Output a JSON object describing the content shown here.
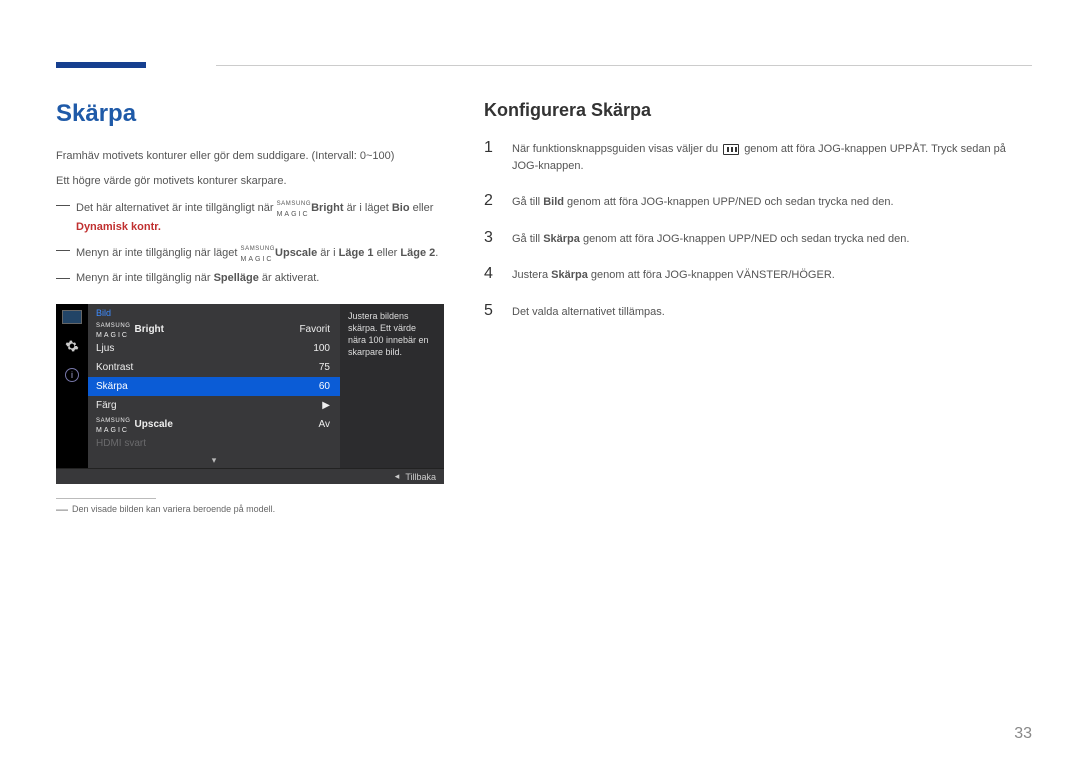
{
  "page_number": "33",
  "left": {
    "title": "Skärpa",
    "p1": "Framhäv motivets konturer eller gör dem suddigare. (Intervall: 0~100)",
    "p2": "Ett högre värde gör motivets konturer skarpare.",
    "note1_pre": "Det här alternativet är inte tillgängligt när ",
    "note1_brand_top": "SAMSUNG",
    "note1_brand_bot": "MAGIC",
    "note1_bright": "Bright",
    "note1_mid": " är i läget ",
    "note1_bio": "Bio",
    "note1_eller": " eller ",
    "note1_dyn": "Dynamisk kontr.",
    "note2_pre": "Menyn är inte tillgänglig när läget ",
    "note2_brand_top": "SAMSUNG",
    "note2_brand_bot": "MAGIC",
    "note2_upscale": "Upscale",
    "note2_mid": " är i ",
    "note2_l1": "Läge 1",
    "note2_eller": " eller ",
    "note2_l2": "Läge 2",
    "note2_end": ".",
    "note3_pre": "Menyn är inte tillgänglig när ",
    "note3_spel": "Spelläge",
    "note3_end": " är aktiverat.",
    "osd": {
      "header": "Bild",
      "rows": [
        {
          "label_brand_top": "SAMSUNG",
          "label_brand_bot": "MAGIC",
          "label_suffix": "Bright",
          "value": "Favorit"
        },
        {
          "label": "Ljus",
          "value": "100"
        },
        {
          "label": "Kontrast",
          "value": "75"
        },
        {
          "label": "Skärpa",
          "value": "60",
          "selected": true
        },
        {
          "label": "Färg",
          "value": "▶"
        },
        {
          "label_brand_top": "SAMSUNG",
          "label_brand_bot": "MAGIC",
          "label_suffix": "Upscale",
          "value": "Av"
        },
        {
          "label": "HDMI svart",
          "value": "",
          "dim": true
        }
      ],
      "desc": "Justera bildens skärpa. Ett värde nära 100 innebär en skarpare bild.",
      "footer_back": "Tillbaka",
      "footer_arrow": "◂"
    },
    "footnote": "Den visade bilden kan variera beroende på modell."
  },
  "right": {
    "title": "Konfigurera Skärpa",
    "steps": [
      {
        "n": "1",
        "pre": "När funktionsknappsguiden visas väljer du ",
        "post": " genom att föra JOG-knappen UPPÅT. Tryck sedan på JOG-knappen."
      },
      {
        "n": "2",
        "pre": "Gå till ",
        "b": "Bild",
        "post": " genom att föra JOG-knappen UPP/NED och sedan trycka ned den."
      },
      {
        "n": "3",
        "pre": "Gå till ",
        "b": "Skärpa",
        "post": " genom att föra JOG-knappen UPP/NED och sedan trycka ned den."
      },
      {
        "n": "4",
        "pre": "Justera ",
        "b": "Skärpa",
        "post": " genom att föra JOG-knappen VÄNSTER/HÖGER."
      },
      {
        "n": "5",
        "txt": "Det valda alternativet tillämpas."
      }
    ]
  }
}
